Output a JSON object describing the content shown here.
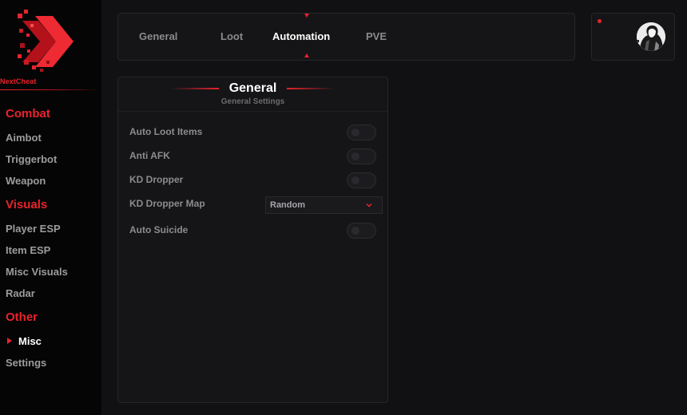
{
  "brand": {
    "name": "NextCheat"
  },
  "sidebar": {
    "sections": [
      {
        "title": "Combat",
        "items": [
          "Aimbot",
          "Triggerbot",
          "Weapon"
        ]
      },
      {
        "title": "Visuals",
        "items": [
          "Player ESP",
          "Item ESP",
          "Misc Visuals",
          "Radar"
        ]
      },
      {
        "title": "Other",
        "items": [
          "Misc",
          "Settings"
        ]
      }
    ],
    "active_item": "Misc"
  },
  "tabs": [
    {
      "label": "General",
      "active": false
    },
    {
      "label": "Loot",
      "active": false
    },
    {
      "label": "Automation",
      "active": true
    },
    {
      "label": "PVE",
      "active": false
    }
  ],
  "profile": {
    "status": "online",
    "avatar_icon": "user-avatar"
  },
  "panel": {
    "title": "General",
    "subtitle": "General Settings",
    "rows": [
      {
        "label": "Auto Loot Items",
        "type": "toggle",
        "value": false
      },
      {
        "label": "Anti AFK",
        "type": "toggle",
        "value": false
      },
      {
        "label": "KD Dropper",
        "type": "toggle",
        "value": false
      },
      {
        "label": "KD Dropper Map",
        "type": "select",
        "value": "Random"
      },
      {
        "label": "Auto Suicide",
        "type": "toggle",
        "value": false
      }
    ]
  },
  "colors": {
    "accent": "#e8232c",
    "background": "#111113",
    "sidebar": "#050505",
    "panel": "#151517",
    "text_muted": "#9c9c9c"
  }
}
